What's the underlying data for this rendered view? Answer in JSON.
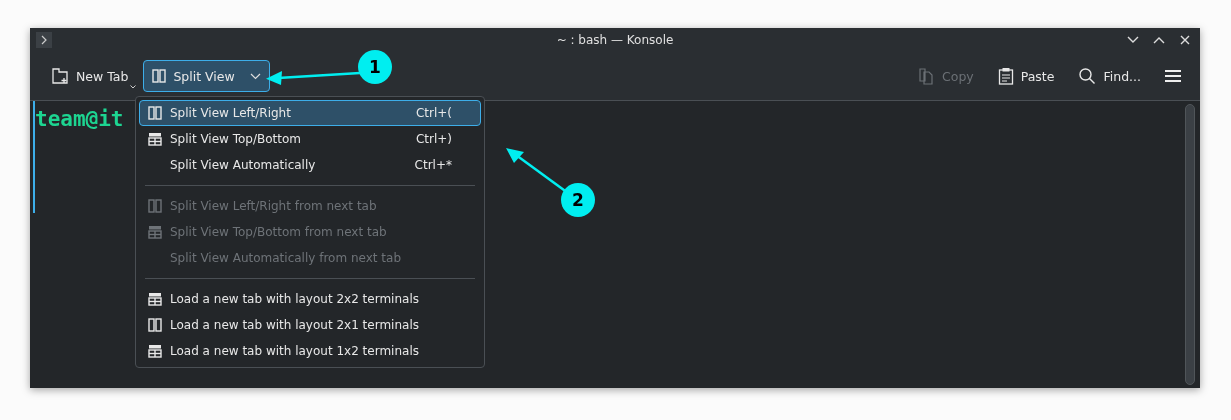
{
  "window": {
    "title": "~ : bash — Konsole"
  },
  "toolbar": {
    "left": [
      {
        "kind": "new-tab",
        "label": "New Tab",
        "selected": false,
        "disabled": false
      },
      {
        "kind": "split",
        "label": "Split View",
        "selected": true,
        "disabled": false
      }
    ],
    "right": [
      {
        "kind": "copy",
        "label": "Copy",
        "disabled": true
      },
      {
        "kind": "paste",
        "label": "Paste",
        "disabled": false
      },
      {
        "kind": "find",
        "label": "Find...",
        "disabled": false
      }
    ]
  },
  "terminal": {
    "prompt": "team@it"
  },
  "menu": {
    "sections": [
      [
        {
          "kind": "columns",
          "label": "Split View Left/Right",
          "shortcut": "Ctrl+(",
          "selected": true,
          "disabled": false
        },
        {
          "kind": "rows",
          "label": "Split View Top/Bottom",
          "shortcut": "Ctrl+)",
          "selected": false,
          "disabled": false
        },
        {
          "kind": "plain",
          "label": "Split View Automatically",
          "shortcut": "Ctrl+*",
          "selected": false,
          "disabled": false
        }
      ],
      [
        {
          "kind": "columns",
          "label": "Split View Left/Right from next tab",
          "selected": false,
          "disabled": true
        },
        {
          "kind": "rows",
          "label": "Split View Top/Bottom from next tab",
          "selected": false,
          "disabled": true
        },
        {
          "kind": "plain",
          "label": "Split View Automatically from next tab",
          "selected": false,
          "disabled": true
        }
      ],
      [
        {
          "kind": "rows",
          "label": "Load a new tab with layout 2x2 terminals",
          "selected": false,
          "disabled": false
        },
        {
          "kind": "columns",
          "label": "Load a new tab with layout 2x1 terminals",
          "selected": false,
          "disabled": false
        },
        {
          "kind": "rows",
          "label": "Load a new tab with layout 1x2 terminals",
          "selected": false,
          "disabled": false
        }
      ]
    ]
  },
  "annotations": [
    {
      "label": "1"
    },
    {
      "label": "2"
    }
  ]
}
